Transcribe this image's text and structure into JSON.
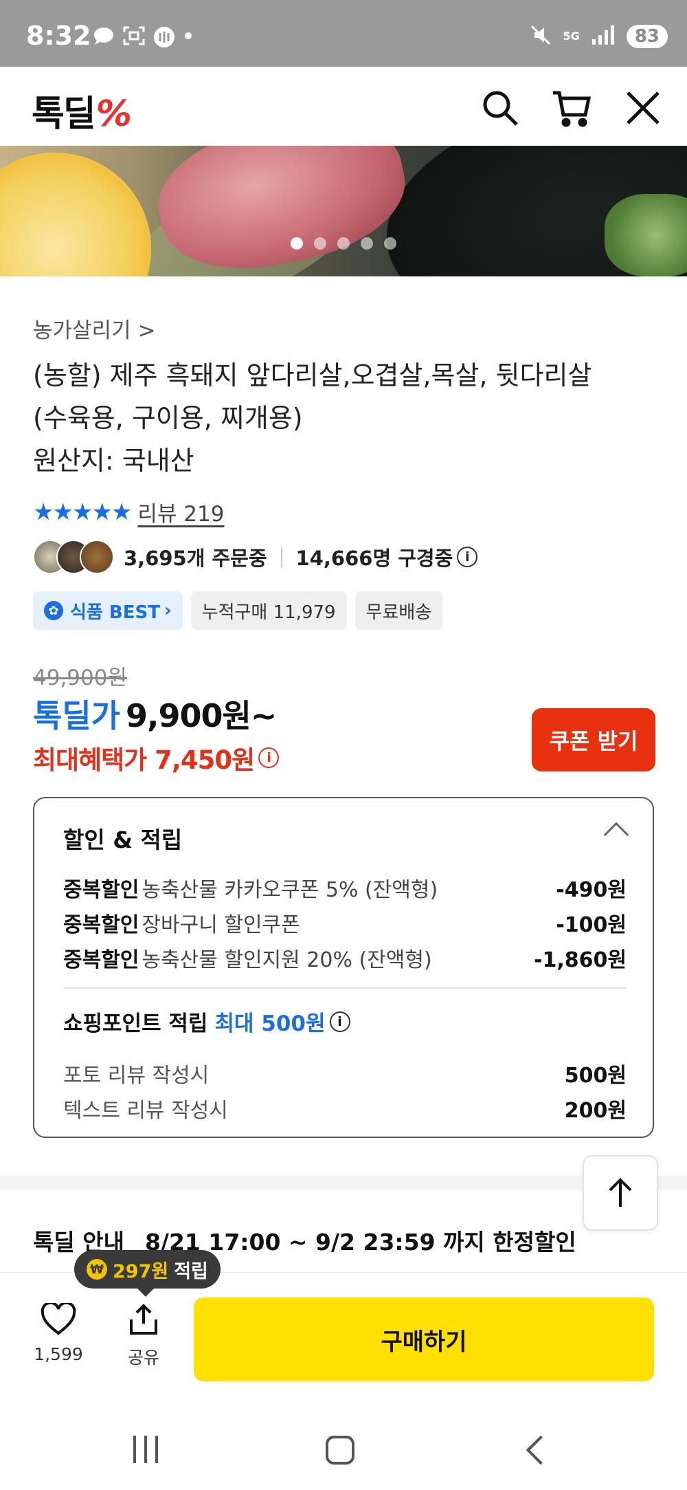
{
  "status_bar": {
    "time": "8:32",
    "battery": "83",
    "network": "5G"
  },
  "header": {
    "logo_text": "톡딜",
    "logo_mark": "%"
  },
  "carousel": {
    "total": 5,
    "active_index": 0
  },
  "product": {
    "brand_link": "농가살리기 >",
    "title_lines": [
      "(농할) 제주 흑돼지 앞다리살,오겹살,목살, 뒷다리살",
      "(수육용, 구이용, 찌개용)",
      "원산지: 국내산"
    ],
    "stars": "★★★★★",
    "review_label": "리뷰 219",
    "orders_label": "3,695개 주문중",
    "viewers_label": "14,666명 구경중",
    "tags": {
      "best": "식품 BEST",
      "cumulative": "누적구매 11,979",
      "shipping": "무료배송"
    }
  },
  "pricing": {
    "original": "49,900원",
    "deal_label": "톡딜가",
    "deal_price": "9,900원~",
    "max_benefit": "최대혜택가 7,450원",
    "coupon_button": "쿠폰 받기"
  },
  "discount_box": {
    "title": "할인 & 적립",
    "rows": [
      {
        "type": "중복할인",
        "desc": "농축산물 카카오쿠폰 5% (잔액형)",
        "amount": "-490원"
      },
      {
        "type": "중복할인",
        "desc": "장바구니 할인쿠폰",
        "amount": "-100원"
      },
      {
        "type": "중복할인",
        "desc": "농축산물 할인지원 20% (잔액형)",
        "amount": "-1,860원"
      }
    ],
    "points_title": "쇼핑포인트 적립",
    "points_max": "최대 500원",
    "point_rows": [
      {
        "label": "포토 리뷰 작성시",
        "amount": "500원"
      },
      {
        "label": "텍스트 리뷰 작성시",
        "amount": "200원"
      }
    ]
  },
  "notice": {
    "label": "톡딜 안내",
    "period": "8/21 17:00 ~ 9/2 23:59 까지 한정할인"
  },
  "bottom_bar": {
    "tooltip_amount": "297원",
    "tooltip_suffix": "적립",
    "like_count": "1,599",
    "share_label": "공유",
    "buy_button": "구매하기"
  },
  "colors": {
    "accent_blue": "#1a6fe0",
    "accent_red": "#e0321b",
    "buy_yellow": "#ffe000"
  }
}
